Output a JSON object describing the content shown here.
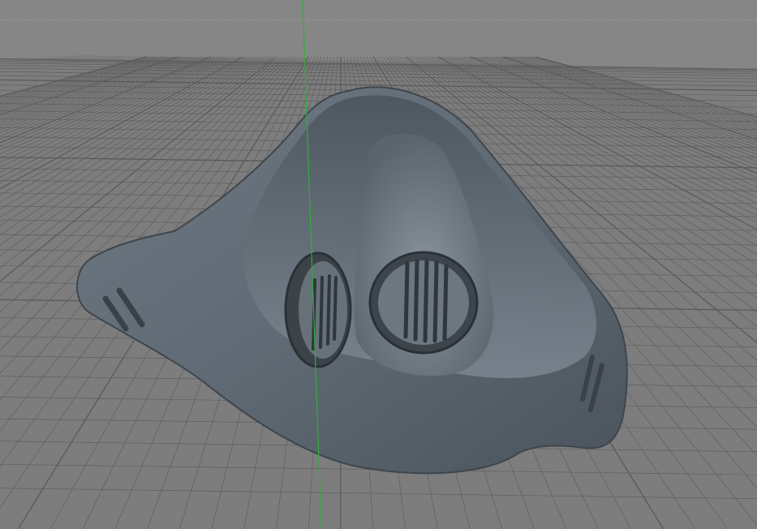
{
  "viewport": {
    "background_color": "#868686",
    "floor_color": "#7d7d7d",
    "grid_color": "#5a5a5a",
    "y_axis_color": "#2fae3a",
    "model": {
      "name": "respirator-mask",
      "body_color": "#5f6a74",
      "highlight_color": "#8f9aa4",
      "shadow_color": "#3a4148"
    }
  }
}
